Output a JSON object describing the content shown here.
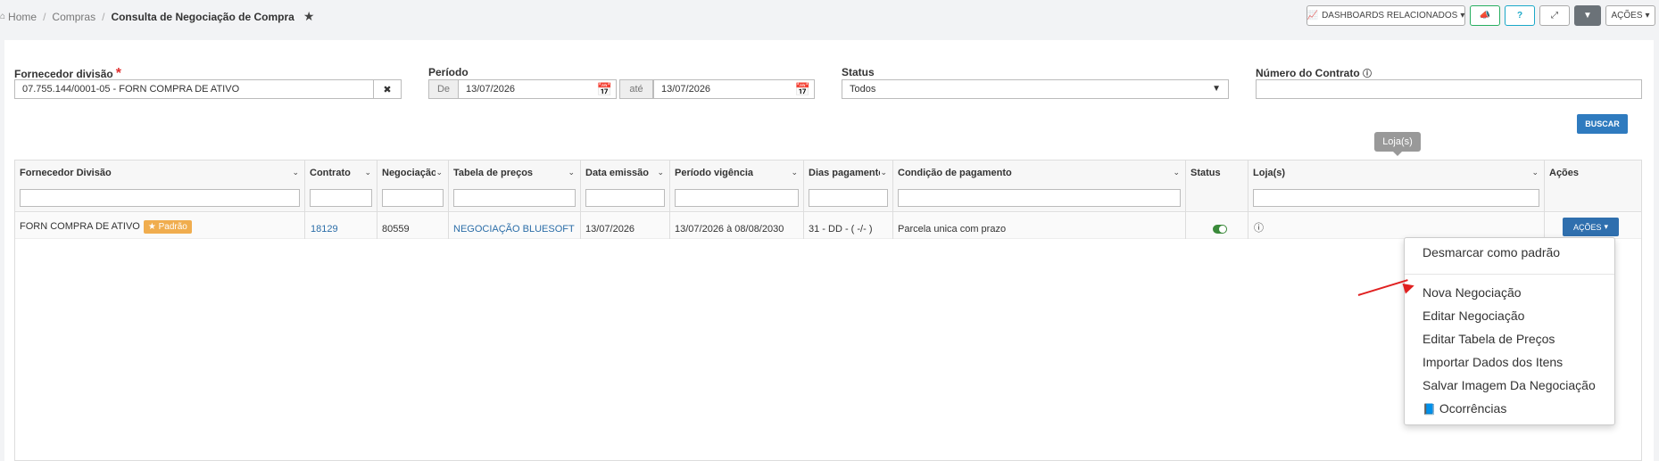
{
  "breadcrumb": {
    "home": "Home",
    "section": "Compras",
    "current": "Consulta de Negociação de Compra"
  },
  "toolbar": {
    "dashboards": "DASHBOARDS RELACIONADOS",
    "acoes": "AÇÕES"
  },
  "filters": {
    "fornecedor_label": "Fornecedor divisão",
    "fornecedor_value": "07.755.144/0001-05 - FORN COMPRA DE ATIVO",
    "periodo_label": "Período",
    "de_label": "De",
    "de_value": "13/07/2026",
    "ate_label": "até",
    "ate_value": "13/07/2026",
    "status_label": "Status",
    "status_value": "Todos",
    "contrato_label": "Número do Contrato",
    "buscar": "BUSCAR"
  },
  "tooltip": "Loja(s)",
  "table": {
    "columns": [
      "Fornecedor Divisão",
      "Contrato",
      "Negociação",
      "Tabela de preços",
      "Data emissão",
      "Período vigência",
      "Dias pagamento",
      "Condição de pagamento",
      "Status",
      "Loja(s)",
      "Ações"
    ],
    "row": {
      "fornecedor": "FORN COMPRA DE ATIVO",
      "badge": "Padrão",
      "contrato": "18129",
      "negociacao": "80559",
      "tabela": "NEGOCIAÇÃO BLUESOFT",
      "data_emissao": "13/07/2026",
      "periodo": "13/07/2026 à 08/08/2030",
      "dias": "31 - DD - ( -/- )",
      "condicao": "Parcela unica com prazo",
      "acoes": "AÇÕES"
    }
  },
  "dropdown": {
    "items": [
      "Desmarcar como padrão",
      "Nova Negociação",
      "Editar Negociação",
      "Editar Tabela de Preços",
      "Importar Dados dos Itens",
      "Salvar Imagem Da Negociação",
      "Ocorrências"
    ]
  },
  "colors": {
    "primary": "#2f7bbf",
    "badge": "#f0ad4e",
    "annotation": "#e02020"
  }
}
